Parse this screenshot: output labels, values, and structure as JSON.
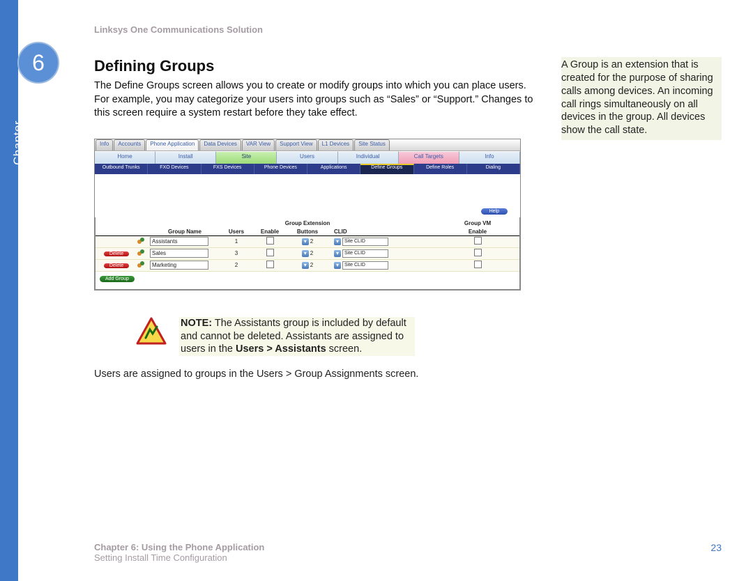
{
  "doc_title": "Linksys One Communications Solution",
  "chapter_number": "6",
  "chapter_label": "Chapter",
  "section_heading": "Defining Groups",
  "intro_paragraph": "The Define Groups screen allows you to create or modify groups into which you can place users. For example, you may categorize your users into groups such as “Sales” or “Support.” Changes to this screen require a system restart before they take effect.",
  "side_note": "A Group is an extension that is created for the purpose of sharing calls among devices. An incoming call rings simultaneously on all devices in the group. All devices show the call state.",
  "screenshot": {
    "top_tabs": [
      "Info",
      "Accounts",
      "Phone Application",
      "Data Devices",
      "VAR View",
      "Support View",
      "L1 Devices",
      "Site Status"
    ],
    "top_tab_active_index": 2,
    "nav_tabs": [
      {
        "label": "Home",
        "style": "plain"
      },
      {
        "label": "Install",
        "style": "plain"
      },
      {
        "label": "Site",
        "style": "green"
      },
      {
        "label": "Users",
        "style": "plain"
      },
      {
        "label": "Individual",
        "style": "plain"
      },
      {
        "label": "Call Targets",
        "style": "pink"
      },
      {
        "label": "Info",
        "style": "plain"
      }
    ],
    "sub_tabs": [
      "Outbound Trunks",
      "FXO Devices",
      "FXS Devices",
      "Phone Devices",
      "Applications",
      "Define Groups",
      "Define Roles",
      "Dialing"
    ],
    "sub_tab_active_index": 5,
    "help_label": "Help",
    "headers_top": {
      "group_ext": "Group Extension",
      "group_vm": "Group VM"
    },
    "headers": {
      "name": "Group Name",
      "users": "Users",
      "enable": "Enable",
      "buttons": "Buttons",
      "clid": "CLID",
      "vm_enable": "Enable"
    },
    "rows": [
      {
        "deletable": false,
        "name": "Assistants",
        "users": "1",
        "buttons": "2",
        "clid": "Site CLID"
      },
      {
        "deletable": true,
        "name": "Sales",
        "users": "3",
        "buttons": "2",
        "clid": "Site CLID"
      },
      {
        "deletable": true,
        "name": "Marketing",
        "users": "2",
        "buttons": "2",
        "clid": "Site CLID"
      }
    ],
    "delete_label": "Delete",
    "add_label": "Add Group"
  },
  "note": {
    "label": "NOTE:",
    "body": " The Assistants group is included by default and cannot be deleted. Assistants are assigned to users in the ",
    "bold_tail": "Users > Assistants",
    "tail": " screen."
  },
  "after_note_pre": "Users are assigned to groups in the ",
  "after_note_bold": "Users > Group Assignments",
  "after_note_post": " screen.",
  "footer": {
    "line1": "Chapter 6: Using the Phone Application",
    "line2": "Setting Install Time Configuration",
    "page": "23"
  }
}
